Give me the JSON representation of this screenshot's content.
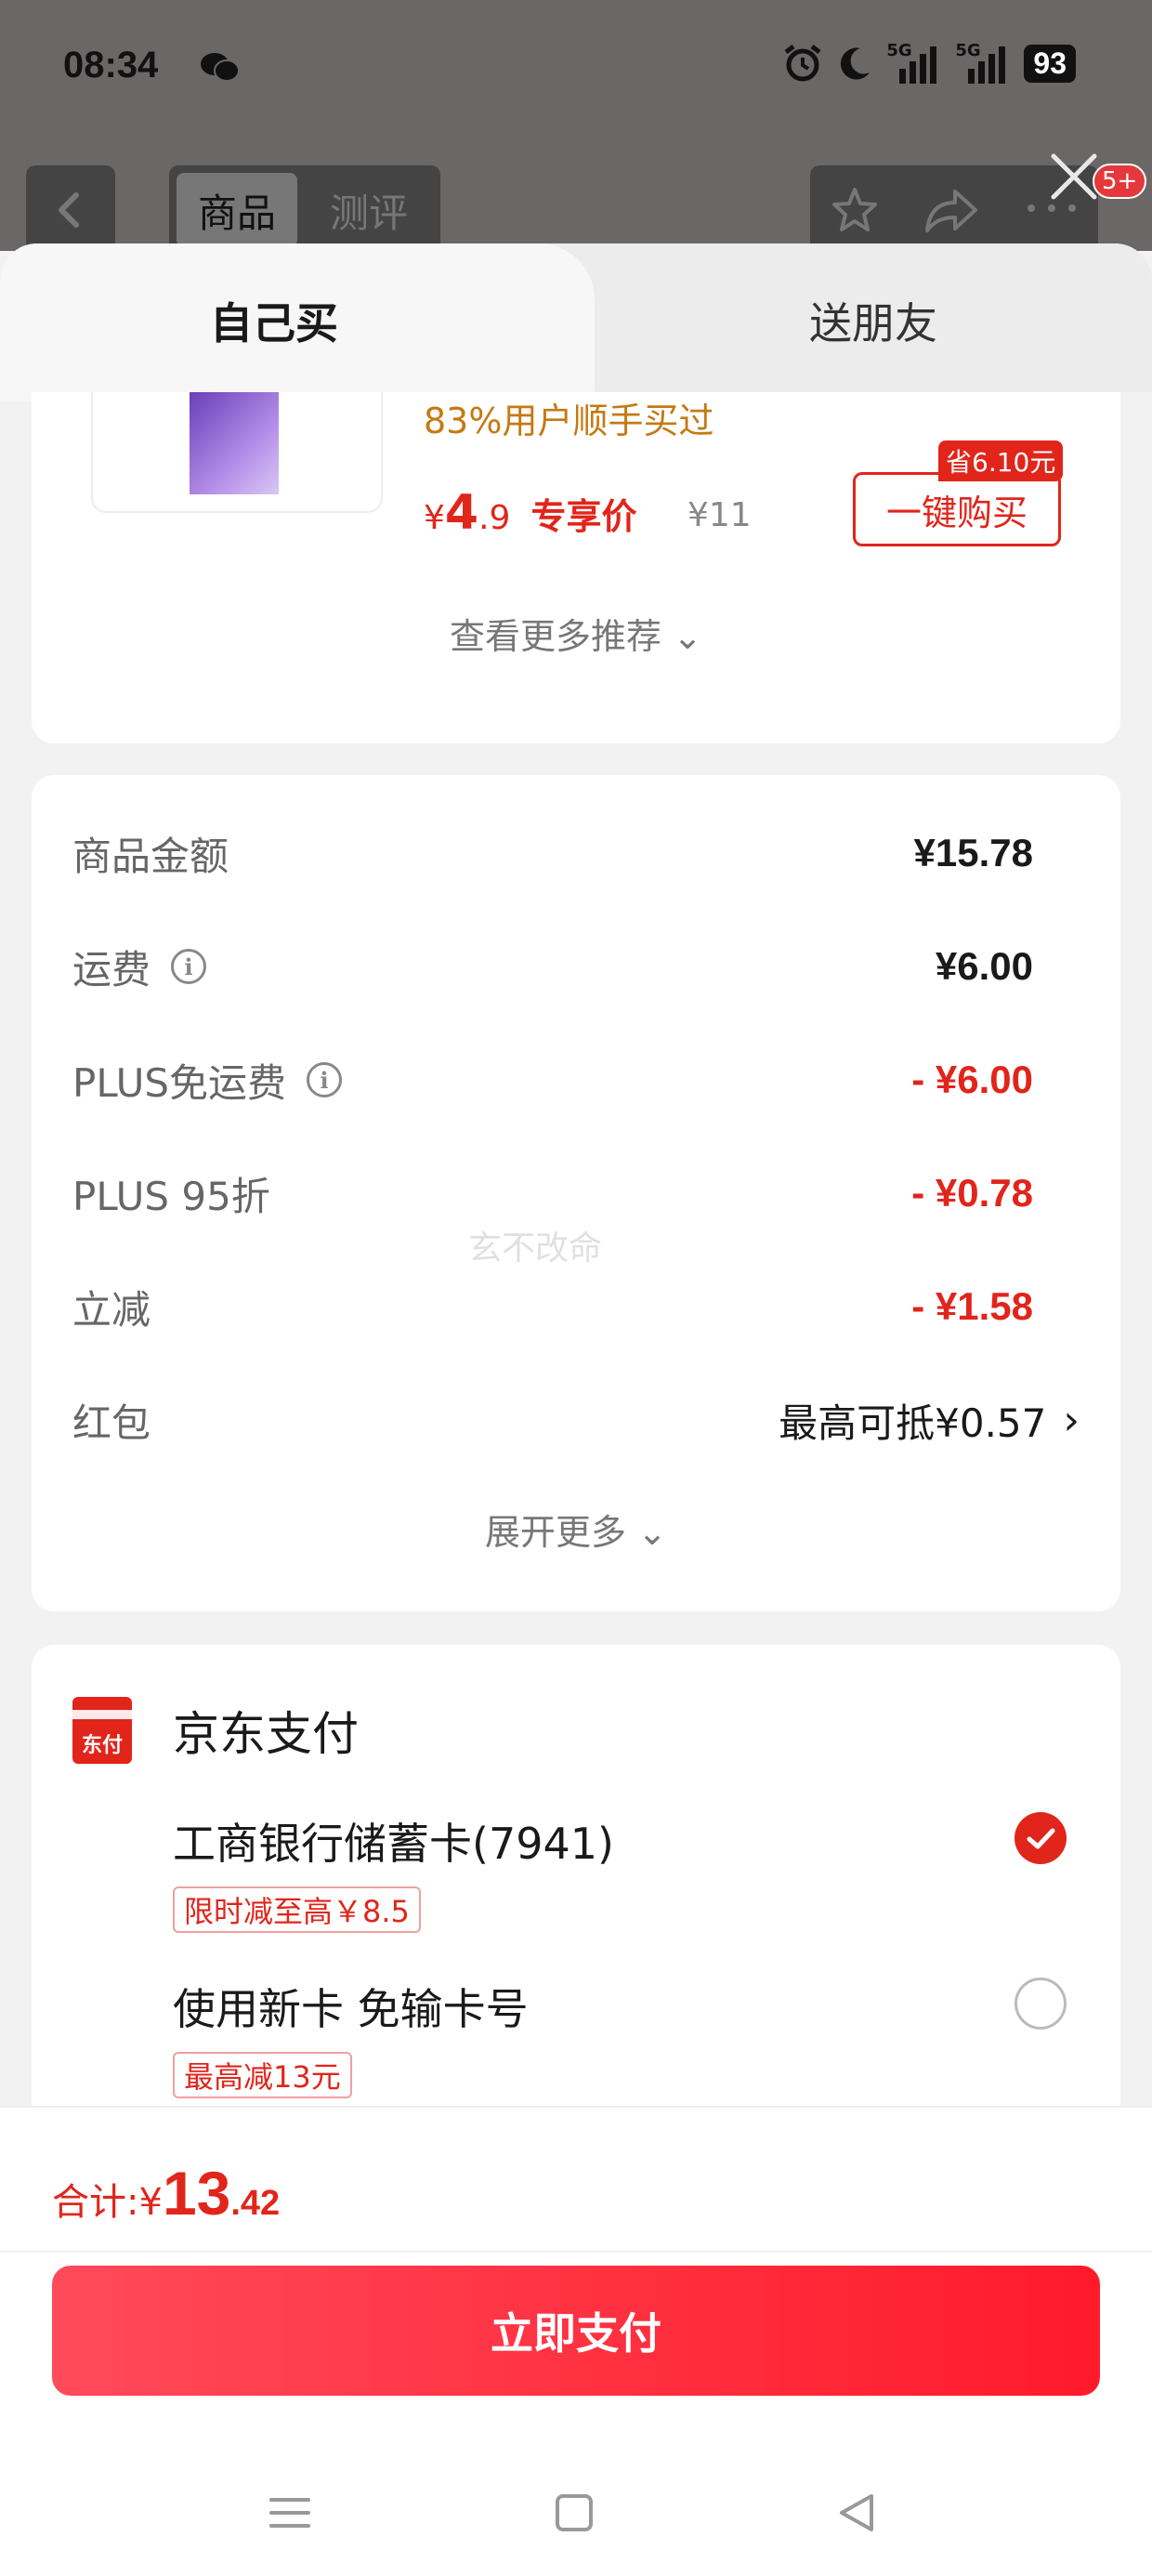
{
  "status_bar": {
    "time": "08:34",
    "net1": "5G",
    "net2": "5G",
    "battery": "93"
  },
  "background_page": {
    "tab_goods": "商品",
    "tab_review": "测评",
    "badge": "5+"
  },
  "sheet_tabs": {
    "self": "自己买",
    "gift": "送朋友"
  },
  "recommend": {
    "bought_text": "83%用户顺手买过",
    "currency": "¥",
    "price_int": "4",
    "price_dec": ".9",
    "exclusive_label": "专享价",
    "original_price": "¥11",
    "save_tag": "省6.10元",
    "buy_button": "一键购买",
    "more_label": "查看更多推荐 ⌄"
  },
  "price_details": {
    "rows": [
      {
        "label": "商品金额",
        "value": "¥15.78"
      },
      {
        "label": "运费",
        "value": "¥6.00"
      },
      {
        "label": "PLUS免运费",
        "value": "- ¥6.00"
      },
      {
        "label": "PLUS 95折",
        "value": "- ¥0.78"
      },
      {
        "label": "立减",
        "value": "- ¥1.58"
      },
      {
        "label": "红包",
        "value": "最高可抵¥0.57"
      }
    ],
    "expand_label": "展开更多 ⌄",
    "watermark": "玄不改命"
  },
  "payment": {
    "logo_text": "东付",
    "title": "京东支付",
    "methods": [
      {
        "name": "工商银行储蓄卡(7941)",
        "tag": "限时减至高￥8.5",
        "selected": true
      },
      {
        "name": "使用新卡 免输卡号",
        "tag": "最高减13元",
        "selected": false
      }
    ]
  },
  "footer": {
    "total_label": "合计: ",
    "currency": "¥",
    "total_int": "13",
    "total_dec": ".42",
    "pay_button": "立即支付"
  },
  "colors": {
    "accent": "#e1251b",
    "bought": "#c47a14",
    "button_from": "#ff4a5a",
    "button_to": "#ff1a2a"
  },
  "icons": [
    "wechat-icon",
    "alarm-icon",
    "moon-icon",
    "signal-icon",
    "back-icon",
    "star-icon",
    "share-icon",
    "more-icon",
    "close-icon",
    "info-icon",
    "chevron-right-icon",
    "check-icon",
    "menu-icon",
    "home-icon",
    "back-triangle-icon"
  ]
}
